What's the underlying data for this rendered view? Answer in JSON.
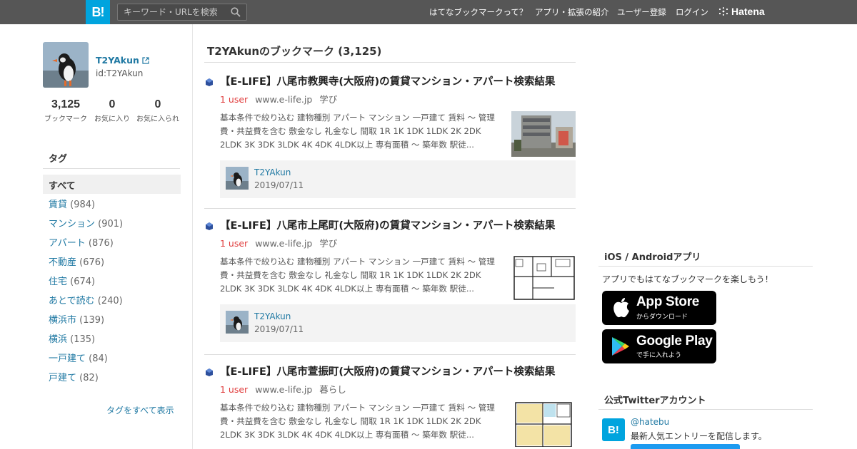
{
  "header": {
    "logo": "B!",
    "search_placeholder": "キーワード・URLを検索",
    "nav": [
      "はてなブックマークって？",
      "アプリ・拡張の紹介",
      "ユーザー登録",
      "ログイン"
    ],
    "hatena": "Hatena"
  },
  "profile": {
    "name": "T2YAkun",
    "id": "id:T2YAkun",
    "stats": [
      {
        "num": "3,125",
        "label": "ブックマーク"
      },
      {
        "num": "0",
        "label": "お気に入り"
      },
      {
        "num": "0",
        "label": "お気に入られ"
      }
    ]
  },
  "tags": {
    "title": "タグ",
    "all": "すべて",
    "items": [
      {
        "name": "賃貸",
        "count": "(984)"
      },
      {
        "name": "マンション",
        "count": "(901)"
      },
      {
        "name": "アパート",
        "count": "(876)"
      },
      {
        "name": "不動産",
        "count": "(676)"
      },
      {
        "name": "住宅",
        "count": "(674)"
      },
      {
        "name": "あとで読む",
        "count": "(240)"
      },
      {
        "name": "横浜市",
        "count": "(139)"
      },
      {
        "name": "横浜",
        "count": "(135)"
      },
      {
        "name": "一戸建て",
        "count": "(84)"
      },
      {
        "name": "戸建て",
        "count": "(82)"
      }
    ],
    "show_all": "タグをすべて表示"
  },
  "main": {
    "title": "T2YAkunのブックマーク (3,125)",
    "entries": [
      {
        "title": "【E-LIFE】八尾市教興寺(大阪府)の賃貸マンション・アパート検索結果",
        "users": "1 user",
        "domain": "www.e-life.jp",
        "category": "学び",
        "desc1": "基本条件で絞り込む 建物種別 アパート マンション 一戸建て 賃料 〜 管理",
        "desc2": "費・共益費を含む 敷金なし 礼金なし 間取 1R 1K 1DK 1LDK 2K 2DK",
        "desc3": "2LDK 3K 3DK 3LDK 4K 4DK 4LDK以上 専有面積 〜 築年数 駅徒...",
        "user": "T2YAkun",
        "date": "2019/07/11"
      },
      {
        "title": "【E-LIFE】八尾市上尾町(大阪府)の賃貸マンション・アパート検索結果",
        "users": "1 user",
        "domain": "www.e-life.jp",
        "category": "学び",
        "desc1": "基本条件で絞り込む 建物種別 アパート マンション 一戸建て 賃料 〜 管理",
        "desc2": "費・共益費を含む 敷金なし 礼金なし 間取 1R 1K 1DK 1LDK 2K 2DK",
        "desc3": "2LDK 3K 3DK 3LDK 4K 4DK 4LDK以上 専有面積 〜 築年数 駅徒...",
        "user": "T2YAkun",
        "date": "2019/07/11"
      },
      {
        "title": "【E-LIFE】八尾市萱振町(大阪府)の賃貸マンション・アパート検索結果",
        "users": "1 user",
        "domain": "www.e-life.jp",
        "category": "暮らし",
        "desc1": "基本条件で絞り込む 建物種別 アパート マンション 一戸建て 賃料 〜 管理",
        "desc2": "費・共益費を含む 敷金なし 礼金なし 間取 1R 1K 1DK 1LDK 2K 2DK",
        "desc3": "2LDK 3K 3DK 3LDK 4K 4DK 4LDK以上 専有面積 〜 築年数 駅徒..."
      }
    ]
  },
  "sidebar": {
    "apps_title": "iOS / Androidアプリ",
    "apps_text": "アプリでもはてなブックマークを楽しもう！",
    "appstore_big": "App Store",
    "appstore_small": "からダウンロード",
    "googleplay_big": "Google Play",
    "googleplay_small": "で手に入れよう",
    "twitter_title": "公式Twitterアカウント",
    "twitter_handle": "@hatebu",
    "twitter_desc": "最新人気エントリーを配信します。"
  },
  "colors": {
    "header_bg": "#565656",
    "brand_blue": "#00a4de",
    "link": "#2079a3",
    "users_red": "#e03c3c"
  }
}
